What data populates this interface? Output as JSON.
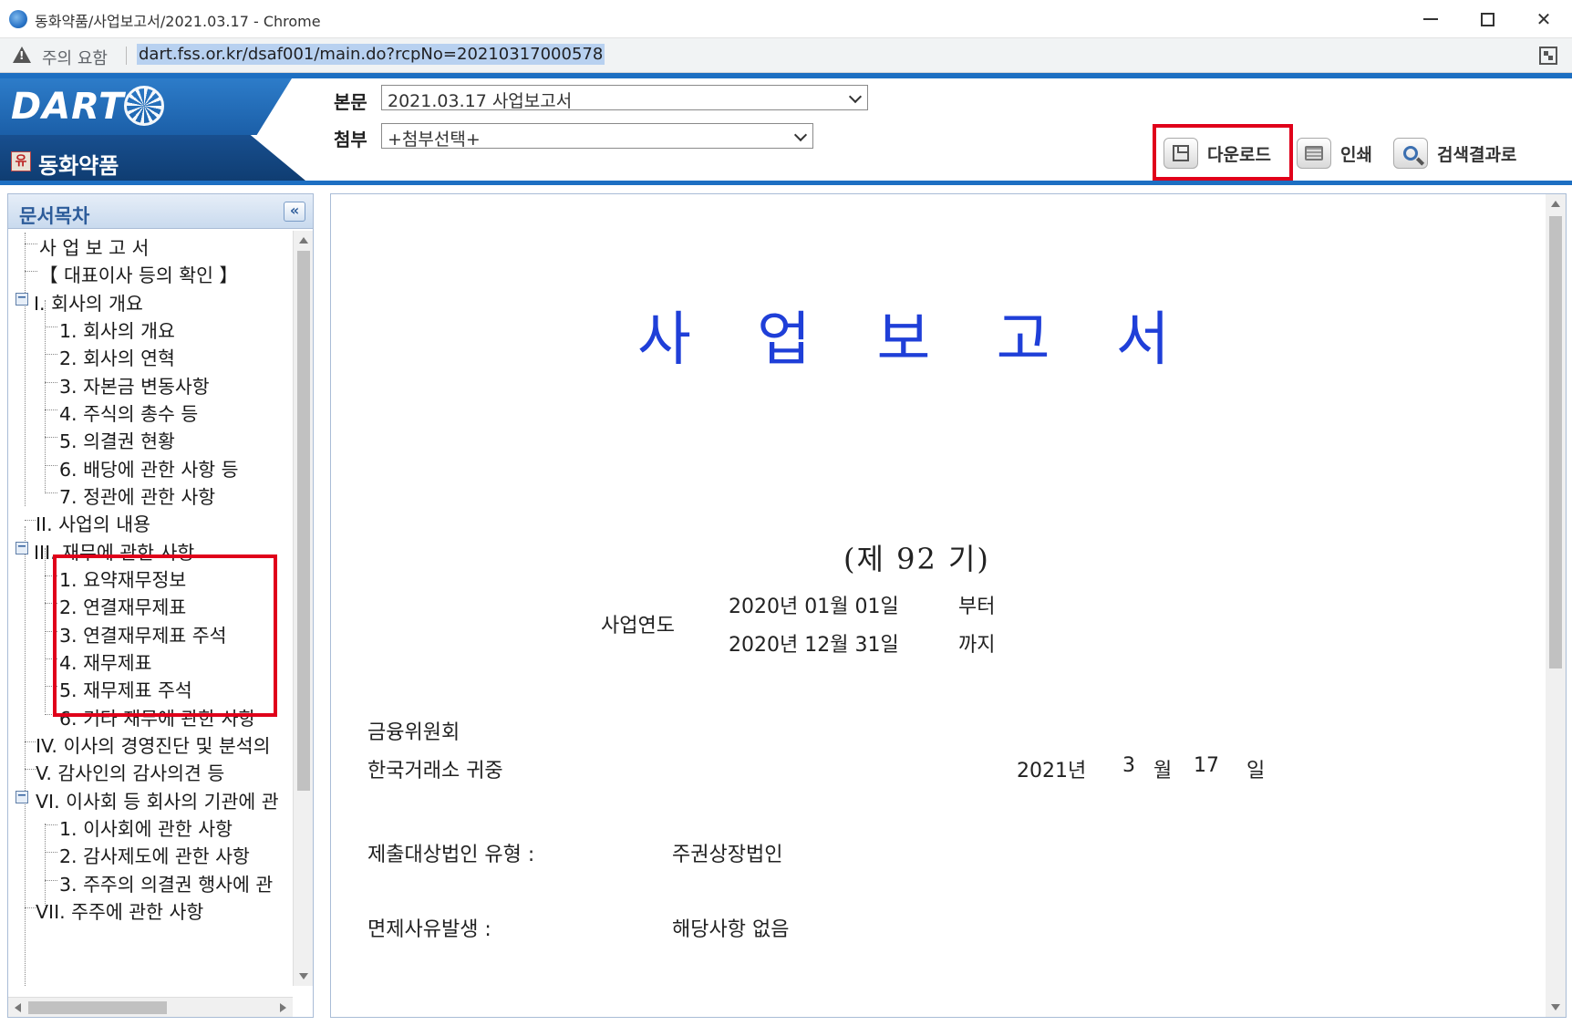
{
  "window": {
    "title": "동화약품/사업보고서/2021.03.17 - Chrome"
  },
  "addressbar": {
    "security_warning": "주의 요함",
    "url": "dart.fss.or.kr/dsaf001/main.do?rcpNo=20210317000578"
  },
  "header": {
    "logo_text": "DART",
    "company_badge": "유",
    "company_name": "동화약품",
    "main_label": "본문",
    "main_value": "2021.03.17  사업보고서",
    "attach_label": "첨부",
    "attach_value": "+첨부선택+",
    "buttons": {
      "download": "다운로드",
      "print": "인쇄",
      "search_results": "검색결과로"
    }
  },
  "sidebar": {
    "title": "문서목차",
    "collapse_glyph": "«",
    "items": [
      {
        "label": "사 업 보 고 서"
      },
      {
        "label": "【 대표이사 등의 확인 】"
      },
      {
        "label": "I. 회사의 개요"
      },
      {
        "label": "1. 회사의 개요"
      },
      {
        "label": "2. 회사의 연혁"
      },
      {
        "label": "3. 자본금 변동사항"
      },
      {
        "label": "4. 주식의 총수 등"
      },
      {
        "label": "5. 의결권 현황"
      },
      {
        "label": "6. 배당에 관한 사항 등"
      },
      {
        "label": "7. 정관에 관한 사항"
      },
      {
        "label": "II. 사업의 내용"
      },
      {
        "label": "III. 재무에 관한 사항"
      },
      {
        "label": "1. 요약재무정보"
      },
      {
        "label": "2. 연결재무제표"
      },
      {
        "label": "3. 연결재무제표 주석"
      },
      {
        "label": "4. 재무제표"
      },
      {
        "label": "5. 재무제표 주석"
      },
      {
        "label": "6. 기타 재무에 관한 사항"
      },
      {
        "label": "IV. 이사의 경영진단 및 분석의"
      },
      {
        "label": "V. 감사인의 감사의견 등"
      },
      {
        "label": "VI. 이사회 등 회사의 기관에 관"
      },
      {
        "label": "1. 이사회에 관한 사항"
      },
      {
        "label": "2. 감사제도에 관한 사항"
      },
      {
        "label": "3. 주주의 의결권 행사에 관"
      },
      {
        "label": "VII. 주주에 관한 사항"
      }
    ]
  },
  "document": {
    "title": "사 업 보 고 서",
    "term": "(제 92 기)",
    "fiscal_year_label": "사업연도",
    "period_start": "2020년 01월 01일",
    "from_label": "부터",
    "period_end": "2020년 12월 31일",
    "to_label": "까지",
    "recipient_1": "금융위원회",
    "recipient_2": "한국거래소 귀중",
    "date_year": "2021년",
    "date_month": "3",
    "month_label": "월",
    "date_day": "17",
    "day_label": "일",
    "corp_type_label": "제출대상법인 유형 :",
    "corp_type_value": "주권상장법인",
    "exemption_label": "면제사유발생 :",
    "exemption_value": "해당사항 없음"
  },
  "colors": {
    "accent_blue": "#1d6fc2",
    "title_blue": "#1f3fd8",
    "highlight_red": "#e0001a"
  }
}
